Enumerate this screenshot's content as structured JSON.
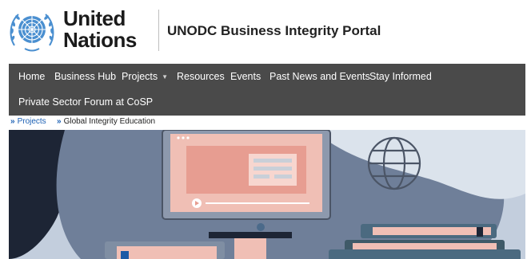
{
  "header": {
    "org_line1": "United",
    "org_line2": "Nations",
    "portal_title": "UNODC Business Integrity Portal"
  },
  "nav": {
    "items": [
      {
        "label": "Home"
      },
      {
        "label": "Business Hub"
      },
      {
        "label": "Projects",
        "has_dropdown": true
      },
      {
        "label": "Resources"
      },
      {
        "label": "Events"
      },
      {
        "label": "Past News and Events"
      },
      {
        "label": "Stay Informed"
      },
      {
        "label": "Private Sector Forum at CoSP"
      }
    ],
    "background": "#4a4a4a"
  },
  "breadcrumb": {
    "separator_icon": "double-chevron-right-icon",
    "items": [
      {
        "label": "Projects"
      },
      {
        "label": "Global Integrity Education"
      }
    ]
  },
  "hero": {
    "illustration": "e-learning-computer-globe-books",
    "colors": {
      "navy": "#1d2535",
      "slate": "#6f7f99",
      "light_blue": "#c3cedd",
      "pink": "#e9b4ab",
      "teal": "#3f5a68"
    }
  }
}
